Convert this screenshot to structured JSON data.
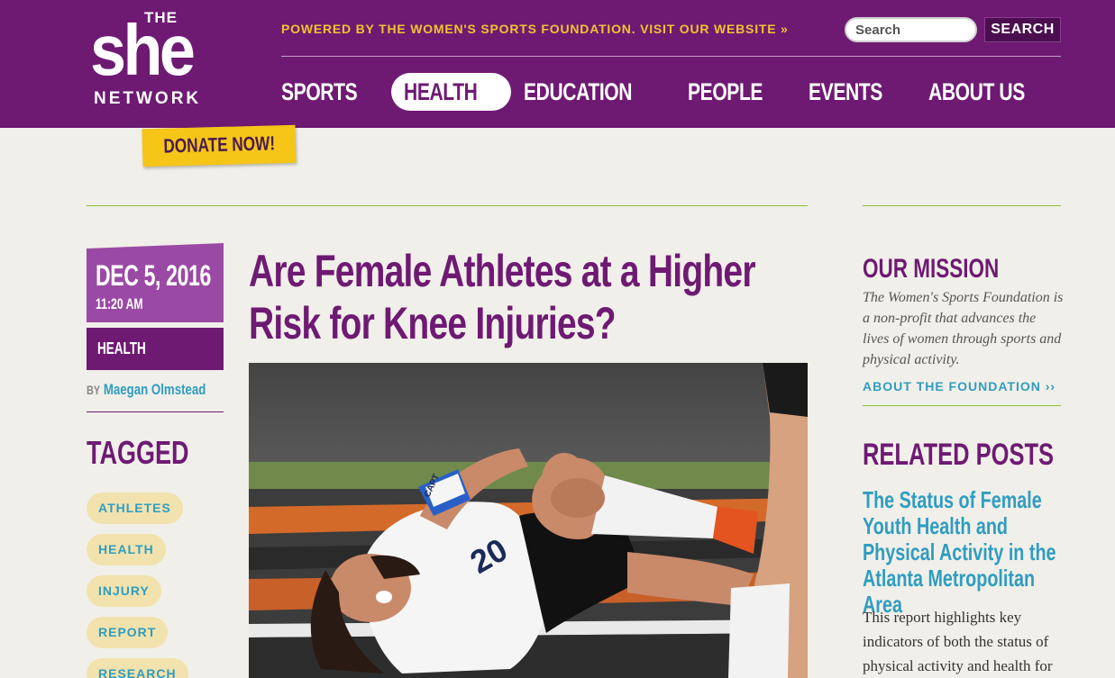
{
  "header": {
    "logo": {
      "the": "THE",
      "she": "she",
      "network": "NETWORK"
    },
    "powered_text": "POWERED BY THE WOMEN'S SPORTS FOUNDATION. VISIT OUR WEBSITE »",
    "search": {
      "placeholder": "Search",
      "button_label": "SEARCH"
    },
    "nav": [
      {
        "label": "SPORTS",
        "active": false
      },
      {
        "label": "HEALTH",
        "active": true
      },
      {
        "label": "EDUCATION",
        "active": false
      },
      {
        "label": "PEOPLE",
        "active": false
      },
      {
        "label": "EVENTS",
        "active": false
      },
      {
        "label": "ABOUT US",
        "active": false
      }
    ],
    "donate_label": "DONATE NOW!"
  },
  "article": {
    "date": "DEC 5, 2016",
    "time": "11:20 AM",
    "category": "HEALTH",
    "by": "BY",
    "author": "Maegan Olmstead",
    "tagged_heading": "TAGGED",
    "tags": [
      "ATHLETES",
      "HEALTH",
      "INJURY",
      "REPORT",
      "RESEARCH"
    ],
    "title": "Are Female Athletes at a Higher Risk for Knee Injuries?",
    "jersey_number": "20",
    "armband": "CAPT"
  },
  "sidebar": {
    "mission_heading": "OUR MISSION",
    "mission_text": "The Women's Sports Foundation is a non-profit that advances the lives of women through sports and physical activity.",
    "about_link": "ABOUT THE FOUNDATION ››",
    "related_heading": "RELATED POSTS",
    "related_title": "The Status of Female Youth Health and Physical Activity in the Atlanta Metropolitan Area",
    "related_text": "This report highlights key indicators of both the status of physical activity and health for"
  },
  "colors": {
    "brand_purple": "#6e1a73",
    "accent_yellow": "#f2c230",
    "link_blue": "#2f9dc0",
    "tag_bg": "#f2e2ad",
    "rule_green": "#8bbf3c"
  }
}
